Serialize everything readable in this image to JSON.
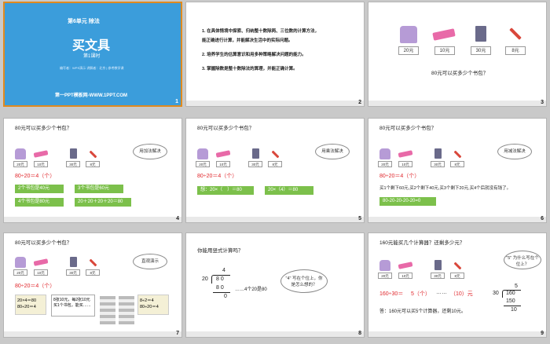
{
  "slide1": {
    "unit": "第6单元 除法",
    "title": "买文具",
    "lesson": "第1课时",
    "credits": "编写者：WPS演示 讲解者：北京 | 参考教学课",
    "site": "第一PPT模板网-WWW.1PPT.COM"
  },
  "slide2": {
    "lines": [
      "1. 在具体情境中探索、归纳整十数除两、三位数的计算方法，",
      "能正确进行计算，并能解决生活中的实际问题。",
      "2. 培养学生的估算意识和用多种策略解决问题的能力。",
      "3. 掌握除数是整十数除法的算理，并能正确计算。"
    ]
  },
  "prices": {
    "bag": "20元",
    "pencase": "10元",
    "calc": "30元",
    "pen": "8元"
  },
  "question": "80元可以买多少个书包？",
  "slide4": {
    "method": "用加法解决",
    "equation": "80÷20＝4（个）",
    "boxes": [
      "2个书包是40元",
      "3个书包是60元",
      "4个书包是80元",
      "20＋20＋20＋20＝80"
    ]
  },
  "slide5": {
    "method": "用乘法解决",
    "equation": "80÷20＝4（个）",
    "boxes": [
      "想：20×（　）＝80",
      "20×（4）＝80"
    ]
  },
  "slide6": {
    "method": "用减法解决",
    "equation": "80÷20＝4（个）",
    "explain": "买1个剩下60元,买2个剩下40元,买3个剩下20元,买4个后就没有钱了。",
    "box": "80-20-20-20-20=0"
  },
  "slide7": {
    "method": "直观演示",
    "equation": "80÷20＝4（个）",
    "card1": [
      "20×4＝80",
      "80÷20＝4"
    ],
    "card2": "8张10元，每2张10元买1个书包，能买……",
    "card3": [
      "8÷2＝4",
      "80÷20＝4"
    ]
  },
  "slide8": {
    "question": "你能用竖式计算吗？",
    "quotient": "4",
    "divisor": "20",
    "dividend": "8 0",
    "product": "8 0",
    "remainder": "0",
    "note": "……4个20是80",
    "bubble": "\"4\" 写在个位上，你是怎么想的？"
  },
  "slide9": {
    "question": "160元能买几个计算器？还剩多少元？",
    "bubble": "\"5\" 为什么写在个位上？",
    "equation_lhs": "160÷30＝",
    "q1": "5（个）",
    "dots": "……",
    "q2": "（10）元",
    "answer": "答：160元可以买5个计算器，还剩10元。",
    "quotient": "5",
    "divisor": "30",
    "dividend": "160",
    "product": "150",
    "remainder": "10"
  },
  "slide_numbers": [
    "1",
    "2",
    "3",
    "4",
    "5",
    "6",
    "7",
    "8",
    "9"
  ],
  "colors": {
    "title_bg": "#3b9ddb",
    "accent_green": "#7cc04b",
    "red": "#e0262b"
  }
}
